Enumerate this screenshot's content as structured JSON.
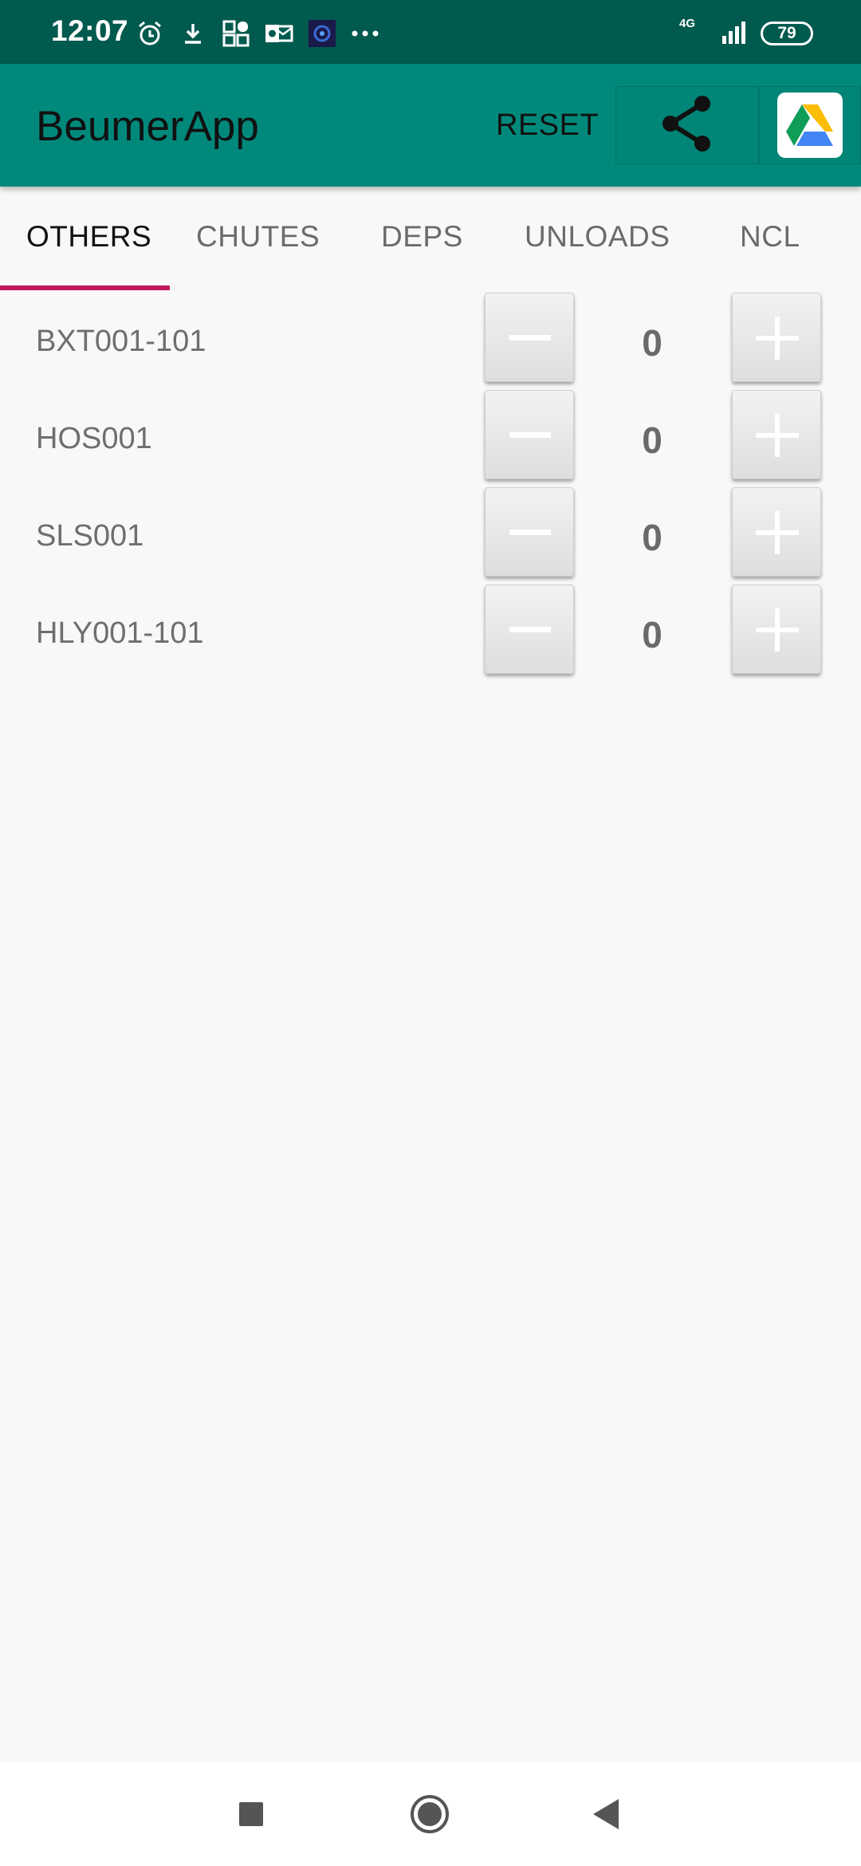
{
  "status_bar": {
    "time": "12:07",
    "network": "4G",
    "battery": "79",
    "left_icons": [
      "alarm-icon",
      "download-icon",
      "qr-grid-icon",
      "outlook-icon",
      "app-thumbnail-icon",
      "more-dots-icon"
    ],
    "right_icons": [
      "signal-icon",
      "battery-icon"
    ]
  },
  "app_bar": {
    "title": "BeumerApp",
    "reset_label": "RESET",
    "share_icon": "share-icon",
    "drive_icon": "google-drive-icon",
    "color": "#00897b"
  },
  "tabs": [
    {
      "label": "OTHERS",
      "active": true
    },
    {
      "label": "CHUTES",
      "active": false
    },
    {
      "label": "DEPS",
      "active": false
    },
    {
      "label": "UNLOADS",
      "active": false
    },
    {
      "label": "NCL",
      "active": false
    }
  ],
  "indicator_color": "#c2185b",
  "rows": [
    {
      "label": "BXT001-101",
      "count": "0"
    },
    {
      "label": "HOS001",
      "count": "0"
    },
    {
      "label": "SLS001",
      "count": "0"
    },
    {
      "label": "HLY001-101",
      "count": "0"
    }
  ],
  "nav_bar": {
    "icons": [
      "recents-square-icon",
      "home-circle-icon",
      "back-triangle-icon"
    ]
  }
}
